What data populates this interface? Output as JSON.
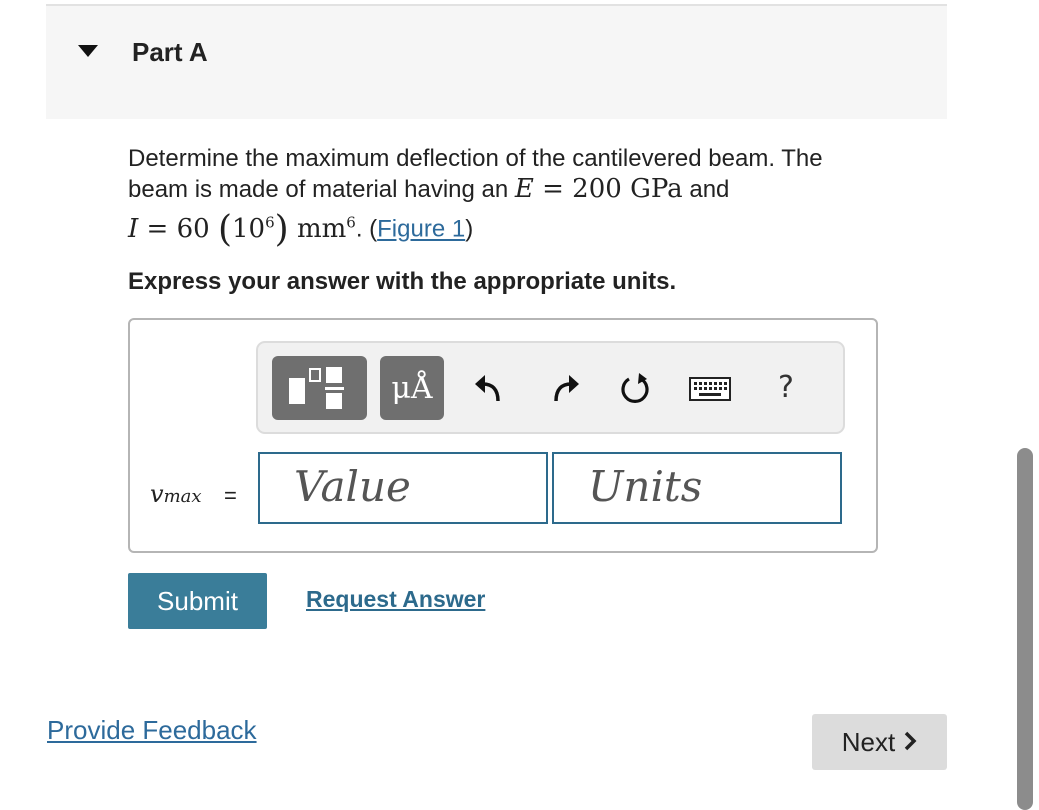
{
  "part": {
    "title": "Part A"
  },
  "question": {
    "line1": "Determine the maximum deflection of the cantilevered beam. The",
    "line2_prefix": "beam is made of material having an ",
    "E_symbol": "E",
    "E_equals": " = 200 GPa",
    "line2_suffix": " and",
    "I_symbol": "I",
    "I_value": " = 60 ",
    "paren_open": "(",
    "ten": "10",
    "six_exp": "6",
    "paren_close": ")",
    "mm": " mm",
    "mm_exp": "6",
    "after_math": ". (",
    "figure_link": "Figure 1",
    "close": ")"
  },
  "instruction": "Express your answer with the appropriate units.",
  "toolbar": {
    "units_label": "μÅ",
    "help_label": "?"
  },
  "answer": {
    "variable": "v",
    "variable_sub": "max",
    "equals": "=",
    "value_placeholder": "Value",
    "units_placeholder": "Units"
  },
  "actions": {
    "submit": "Submit",
    "request_answer": "Request Answer"
  },
  "footer": {
    "provide_feedback": "Provide Feedback",
    "next": "Next"
  },
  "colors": {
    "accent": "#3a7d99",
    "link": "#2d6a9b",
    "toolbar_button": "#6f6f6f"
  }
}
